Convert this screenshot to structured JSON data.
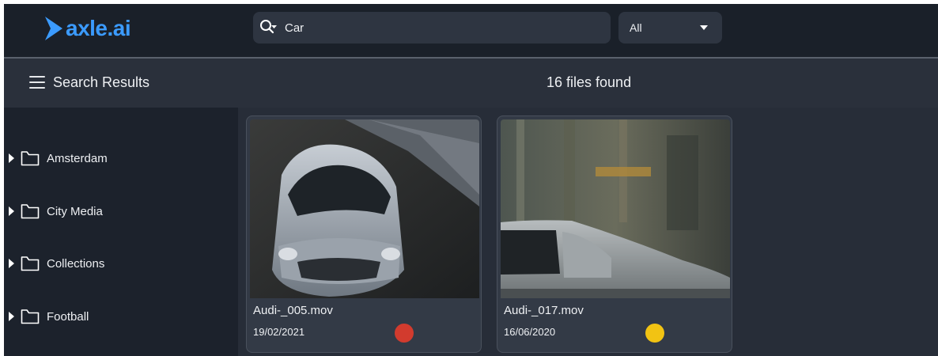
{
  "app": {
    "logo_text": "axle.ai",
    "brand_color": "#3b9bff"
  },
  "search": {
    "value": "Car",
    "icon": "search-filter-icon"
  },
  "filter": {
    "selected": "All"
  },
  "header": {
    "title": "Search Results",
    "count_text": "16 files found"
  },
  "sidebar": {
    "items": [
      {
        "label": "Amsterdam",
        "icon": "folder-icon"
      },
      {
        "label": "City Media",
        "icon": "folder-icon"
      },
      {
        "label": "Collections",
        "icon": "folder-icon"
      },
      {
        "label": "Football",
        "icon": "folder-icon"
      }
    ]
  },
  "results": [
    {
      "name": "Audi-_005.mov",
      "date": "19/02/2021",
      "status_color": "#d23b2e"
    },
    {
      "name": "Audi-_017.mov",
      "date": "16/06/2020",
      "status_color": "#f2c313"
    }
  ]
}
